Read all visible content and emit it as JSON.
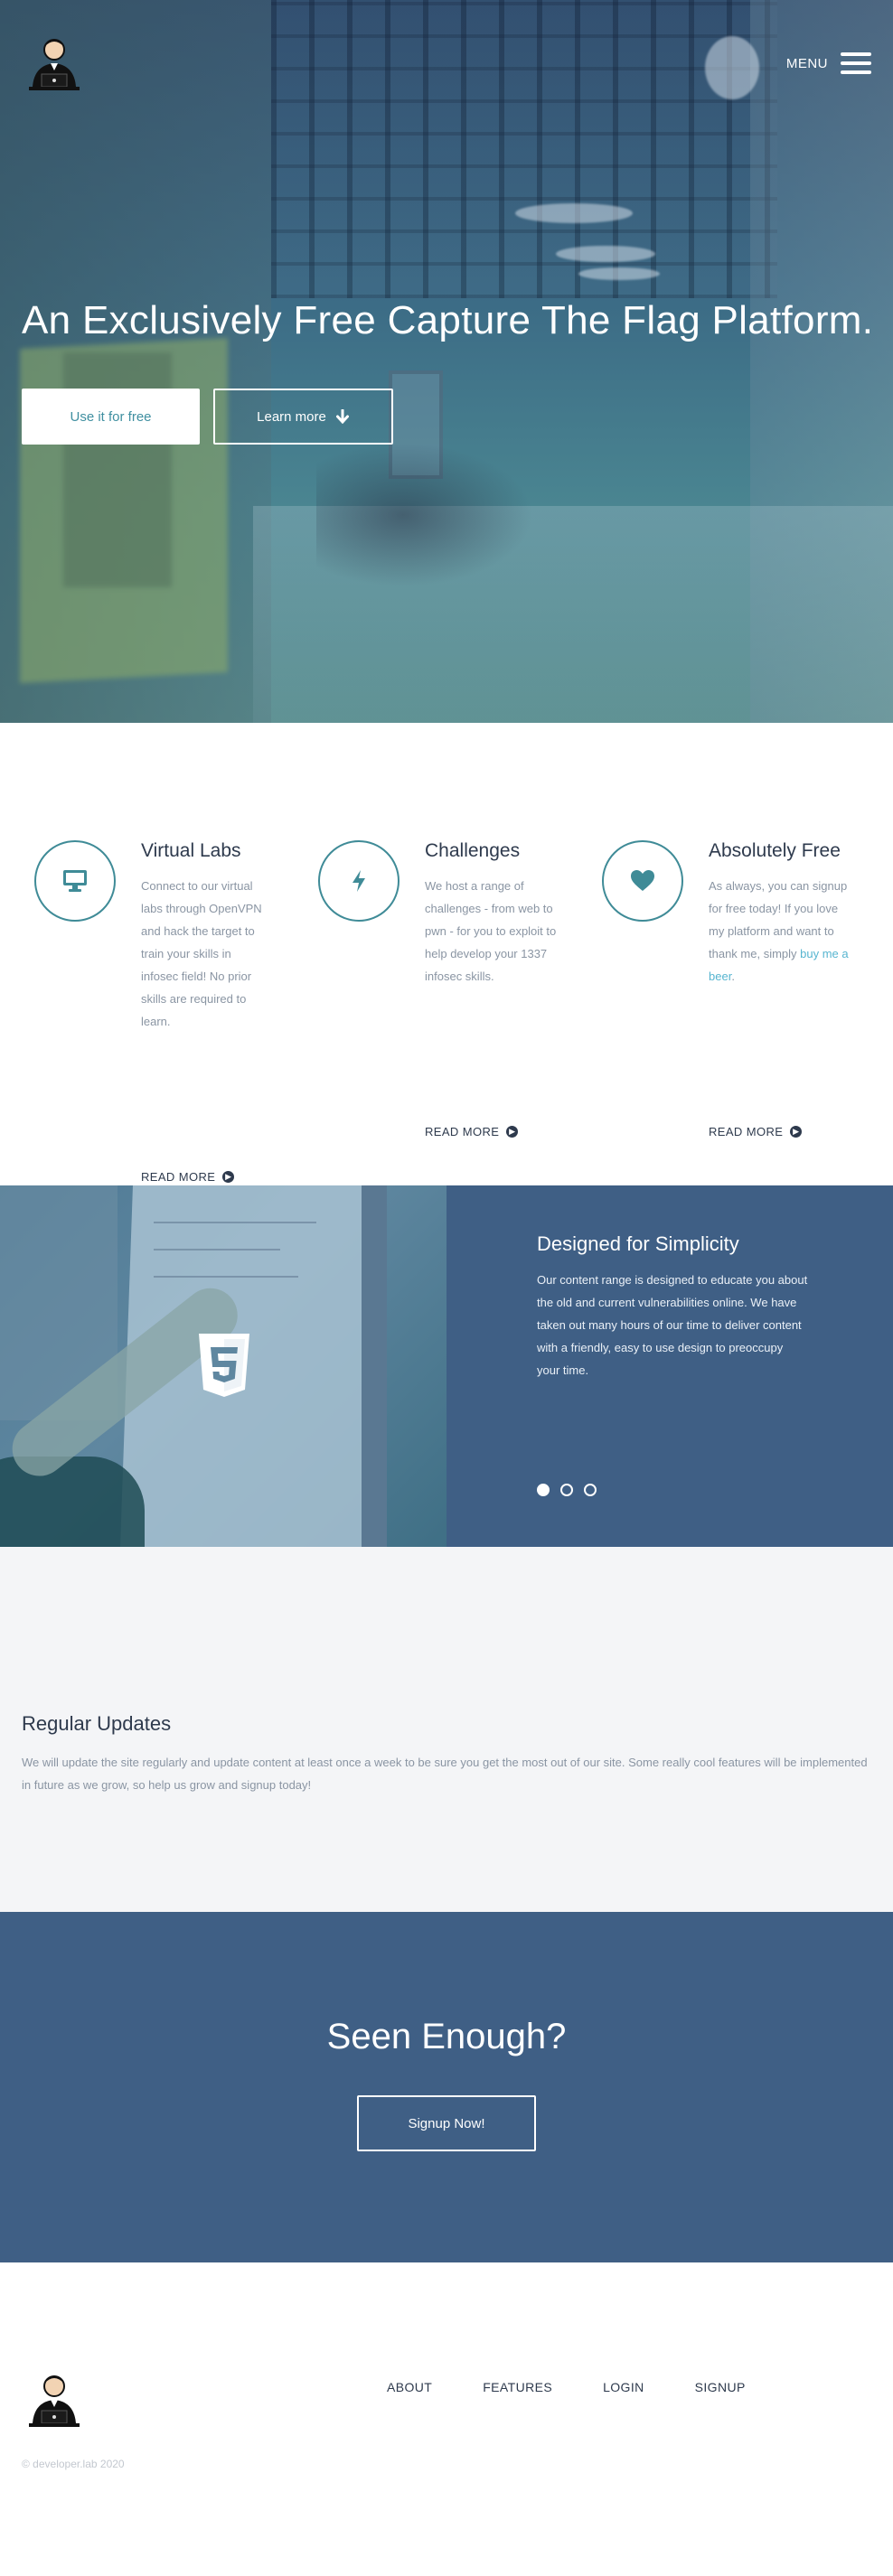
{
  "header": {
    "menu_label": "MENU",
    "menu_icon": "hamburger-icon",
    "logo_icon": "hacker-avatar-icon"
  },
  "hero": {
    "title": "An Exclusively Free Capture The Flag Platform.",
    "primary_button": "Use it for free",
    "secondary_button": "Learn more",
    "secondary_icon": "arrow-down-icon"
  },
  "features": [
    {
      "icon": "monitor-icon",
      "title": "Virtual Labs",
      "text": "Connect to our virtual labs through OpenVPN and hack the target to train your skills in infosec field! No prior skills are required to learn.",
      "read_more": "READ MORE"
    },
    {
      "icon": "lightning-icon",
      "title": "Challenges",
      "text": "We host a range of challenges - from web to pwn - for you to exploit to help develop your 1337 infosec skills.",
      "read_more": "READ MORE"
    },
    {
      "icon": "heart-icon",
      "title": "Absolutely Free",
      "text_before_link": "As always, you can signup for free today! If you love my platform and want to thank me, simply ",
      "link_text": "buy me a beer",
      "text_after_link": ".",
      "read_more": "READ MORE"
    }
  ],
  "simplicity": {
    "title": "Designed for Simplicity",
    "text": "Our content range is designed to educate you about the old and current vulnerabilities online. We have taken out many hours of our time to deliver content with a friendly, easy to use design to preoccupy your time.",
    "image_icon": "html5-icon",
    "slide_count": 3,
    "active_slide": 1
  },
  "updates": {
    "title": "Regular Updates",
    "text": "We will update the site regularly and update content at least once a week to be sure you get the most out of our site. Some really cool features will be implemented in future as we grow, so help us grow and signup today!"
  },
  "cta": {
    "title": "Seen Enough?",
    "button": "Signup Now!"
  },
  "footer": {
    "nav": [
      "ABOUT",
      "FEATURES",
      "LOGIN",
      "SIGNUP"
    ],
    "copyright": "© developer.lab 2020"
  },
  "colors": {
    "accent": "#3f8b97",
    "navy": "#3f5f85",
    "light_bg": "#f4f5f7",
    "link": "#57b5d0"
  }
}
